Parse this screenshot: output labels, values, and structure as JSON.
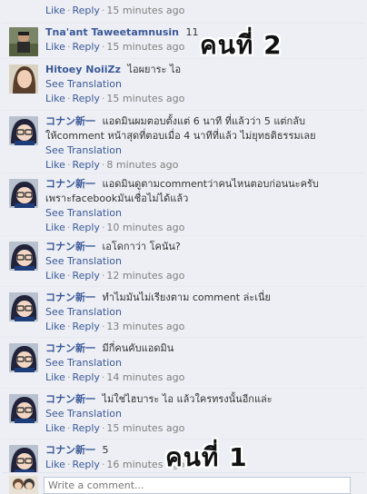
{
  "comments": [
    {
      "author": "",
      "text": "",
      "see_translation": "",
      "like": "Like",
      "reply": "Reply",
      "time": "15 minutes ago",
      "avatar": "none"
    },
    {
      "author": "Tna'ant Taweetamnusin",
      "text": "11",
      "see_translation": "",
      "like": "Like",
      "reply": "Reply",
      "time": "15 minutes ago",
      "avatar": "person-photo"
    },
    {
      "author": "Hitoey NoiiZz",
      "text": "ไอผยาระ ไอ",
      "see_translation": "See Translation",
      "like": "Like",
      "reply": "Reply",
      "time": "15 minutes ago",
      "avatar": "girl-photo"
    },
    {
      "author": "コナン新一",
      "text": "แอดมินผมตอบตั้งแต่ 6 นาที ที่แล้วว่า 5 แต่กลับให้comment หน้าสุดที่ตอบเมื่อ 4 นาทีที่แล้ว ไม่ยุทธติธรรมเลย",
      "see_translation": "See Translation",
      "like": "Like",
      "reply": "Reply",
      "time": "8 minutes ago",
      "avatar": "anime"
    },
    {
      "author": "コナン新一",
      "text": "แอดมินดูตามcommentว่าคนไหนตอบก่อนนะครับ เพราะfacebookมันเชื่อไม่ได้แล้ว",
      "see_translation": "See Translation",
      "like": "Like",
      "reply": "Reply",
      "time": "10 minutes ago",
      "avatar": "anime"
    },
    {
      "author": "コナン新一",
      "text": "เอโดกาว่า โคนัน?",
      "see_translation": "See Translation",
      "like": "Like",
      "reply": "Reply",
      "time": "12 minutes ago",
      "avatar": "anime"
    },
    {
      "author": "コナン新一",
      "text": "ทำไมมันไม่เรียงตาม comment ล่ะเนี่ย",
      "see_translation": "See Translation",
      "like": "Like",
      "reply": "Reply",
      "time": "13 minutes ago",
      "avatar": "anime"
    },
    {
      "author": "コナン新一",
      "text": "มีกี่คนคับแอดมิน",
      "see_translation": "See Translation",
      "like": "Like",
      "reply": "Reply",
      "time": "14 minutes ago",
      "avatar": "anime"
    },
    {
      "author": "コナン新一",
      "text": "ไม่ใช่ไฮบาระ ไอ แล้วใครทรงนั้นอีกแล่ะ",
      "see_translation": "See Translation",
      "like": "Like",
      "reply": "Reply",
      "time": "15 minutes ago",
      "avatar": "anime"
    },
    {
      "author": "コナン新一",
      "text": "5",
      "see_translation": "",
      "like": "Like",
      "reply": "Reply",
      "time": "16 minutes ago",
      "avatar": "anime"
    }
  ],
  "annotations": {
    "person2": "คนที่ 2",
    "person1": "คนที่ 1"
  },
  "composer": {
    "placeholder": "Write a comment..."
  },
  "colors": {
    "link": "#3b5998",
    "meta": "#7f7f7f",
    "background": "#edeff4"
  }
}
